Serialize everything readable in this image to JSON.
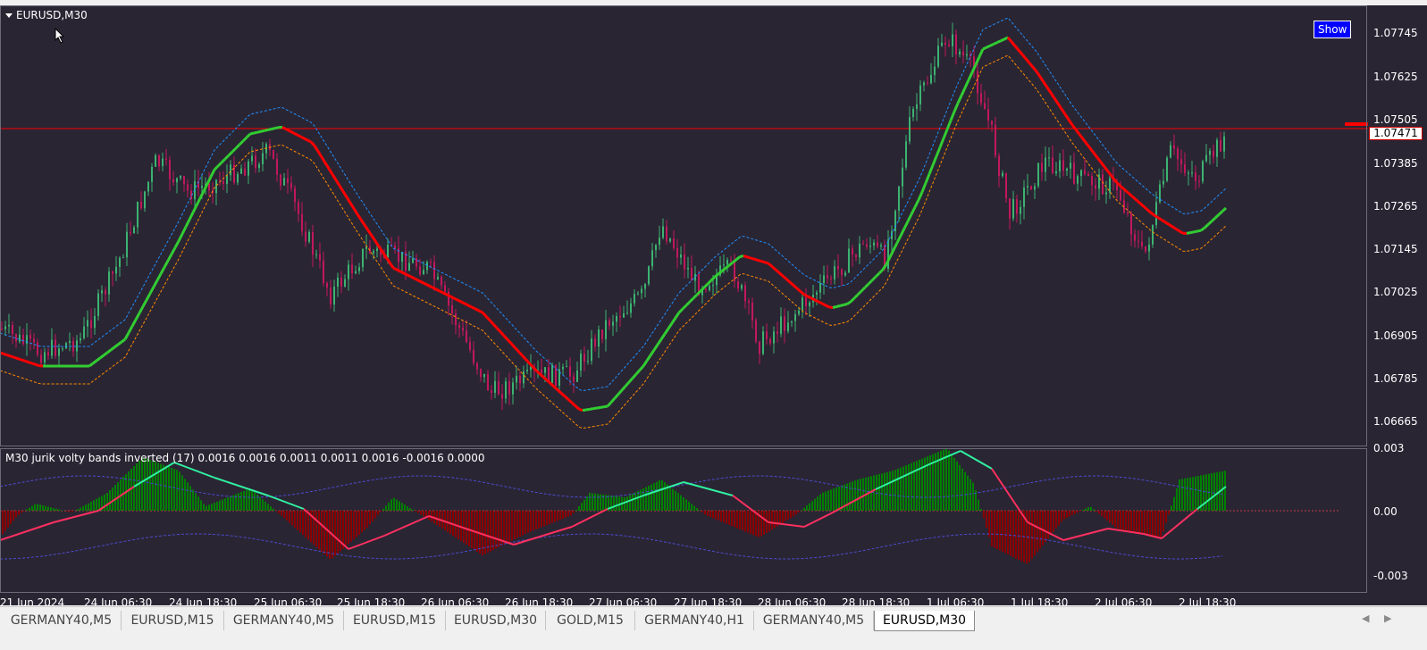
{
  "window": {
    "symbol_label": "EURUSD,M30",
    "show_button": "Show"
  },
  "price_axis": {
    "labels": [
      "1.07745",
      "1.07625",
      "1.07505",
      "1.07385",
      "1.07265",
      "1.07145",
      "1.07025",
      "1.06905",
      "1.06785",
      "1.06665"
    ],
    "current_price": "1.07471"
  },
  "indicator": {
    "label": "M30 jurik volty bands inverted (17) 0.0016 0.0016 0.0011 0.0011 0.0016 -0.0016 0.0000",
    "axis_labels": [
      "0.003",
      "0.00",
      "-0.003"
    ]
  },
  "time_axis": {
    "labels": [
      "21 Jun 2024",
      "24 Jun 06:30",
      "24 Jun 18:30",
      "25 Jun 06:30",
      "25 Jun 18:30",
      "26 Jun 06:30",
      "26 Jun 18:30",
      "27 Jun 06:30",
      "27 Jun 18:30",
      "28 Jun 06:30",
      "28 Jun 18:30",
      "1 Jul 06:30",
      "1 Jul 18:30",
      "2 Jul 06:30",
      "2 Jul 18:30"
    ]
  },
  "tabs": [
    {
      "label": "GERMANY40,M5",
      "active": false
    },
    {
      "label": "EURUSD,M15",
      "active": false
    },
    {
      "label": "GERMANY40,M5",
      "active": false
    },
    {
      "label": "EURUSD,M15",
      "active": false
    },
    {
      "label": "EURUSD,M30",
      "active": false
    },
    {
      "label": "GOLD,M15",
      "active": false
    },
    {
      "label": "GERMANY40,H1",
      "active": false
    },
    {
      "label": "GERMANY40,M5",
      "active": false
    },
    {
      "label": "EURUSD,M30",
      "active": true
    }
  ],
  "colors": {
    "background": "#2a2533",
    "bull_candle": "#3cb371",
    "bear_candle": "#c2185b",
    "rising_band": "#32cd32",
    "falling_band": "#ff0000",
    "upper_dotted": "#1e90ff",
    "lower_dotted": "#ff8c00",
    "hist_up": "#008000",
    "hist_down": "#8b0000",
    "price_line": "#ff0000"
  },
  "icons": {
    "scroll_left": "chevron-left-icon",
    "scroll_right": "chevron-right-icon",
    "cursor": "mouse-pointer-icon"
  }
}
